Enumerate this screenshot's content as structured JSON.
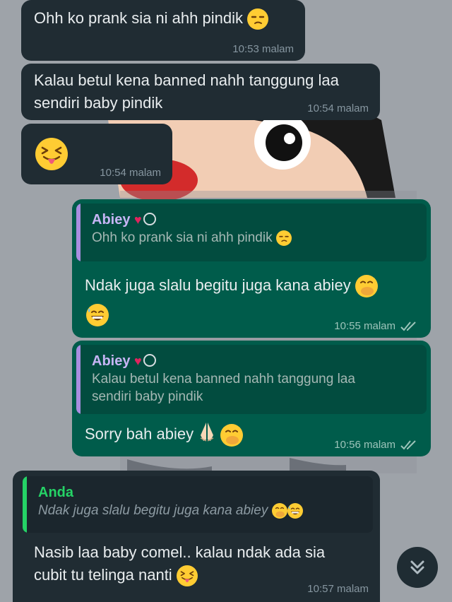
{
  "messages": [
    {
      "id": "m1",
      "dir": "in",
      "text": "Ohh ko prank sia ni ahh pindik",
      "emoji": "unamused-face",
      "time": "10:53 malam"
    },
    {
      "id": "m2",
      "dir": "in",
      "line1": "Kalau betul kena banned nahh tanggung laa",
      "line2": "sendiri baby pindik",
      "time": "10:54 malam"
    },
    {
      "id": "m3",
      "dir": "in",
      "emoji": "squinting-tongue-face",
      "time": "10:54 malam"
    },
    {
      "id": "m4",
      "dir": "out",
      "quote_name": "Abiey",
      "quote_name_icons": [
        "red-heart",
        "ring"
      ],
      "quote_text": "Ohh ko prank sia ni ahh pindik",
      "text": "Ndak juga slalu begitu juga kana abiey",
      "emoji": [
        "hand-over-mouth-face",
        "grinning-sweat-face"
      ],
      "time": "10:55 malam",
      "status": "read-double-check"
    },
    {
      "id": "m5",
      "dir": "out",
      "quote_name": "Abiey",
      "quote_name_icons": [
        "red-heart",
        "ring"
      ],
      "quote_line1": "Kalau betul kena banned nahh tanggung laa",
      "quote_line2": "sendiri baby pindik",
      "text": "Sorry bah abiey",
      "emoji": [
        "folded-hands",
        "hand-over-mouth-face"
      ],
      "time": "10:56 malam",
      "status": "read-double-check"
    },
    {
      "id": "m6",
      "dir": "in",
      "quote_name": "Anda",
      "quote_text": "Ndak juga slalu begitu juga kana abiey",
      "line1": "Nasib laa baby comel.. kalau ndak ada sia",
      "line2": "cubit tu telinga nanti",
      "emoji": "squinting-tongue-face",
      "time": "10:57 malam"
    }
  ],
  "scroll_button": {
    "icon": "double-chevron-down-icon"
  },
  "colors": {
    "incoming": "#202c33",
    "outgoing": "#005c4b",
    "quote_bar_out": "#a88ee0",
    "quote_bar_in": "#25d366",
    "background": "#9aa0a6"
  }
}
